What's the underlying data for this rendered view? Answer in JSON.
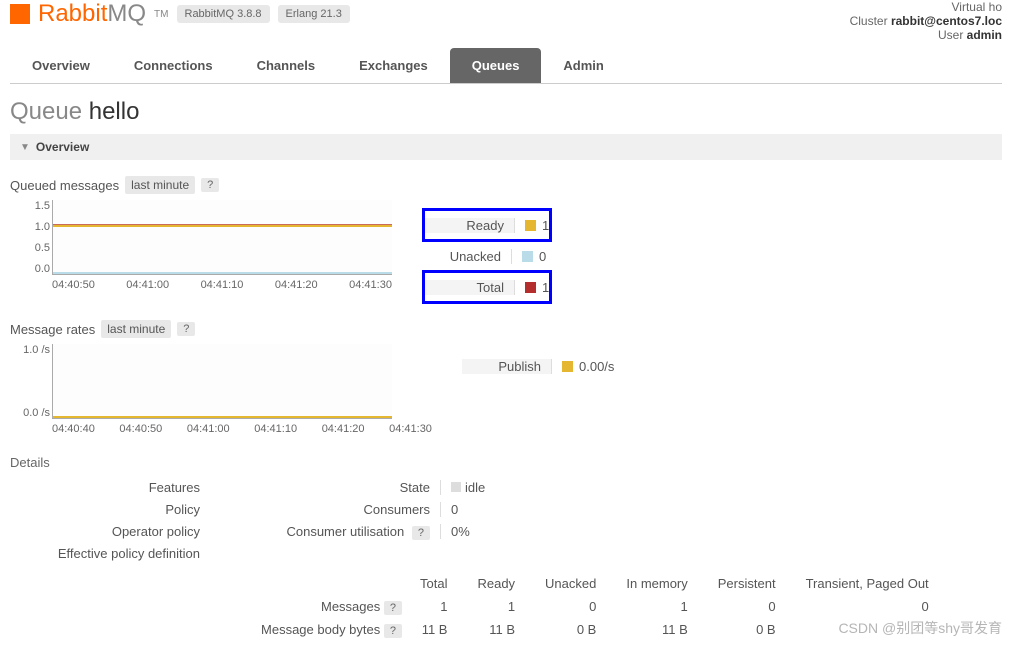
{
  "header": {
    "logo_prefix": "Rabbit",
    "logo_suffix": "MQ",
    "tm": "TM",
    "version": "RabbitMQ 3.8.8",
    "erlang": "Erlang 21.3",
    "virtual_host_label": "Virtual ho",
    "cluster_label": "Cluster ",
    "cluster_value": "rabbit@centos7.loc",
    "user_label": "User ",
    "user_value": "admin"
  },
  "tabs": [
    "Overview",
    "Connections",
    "Channels",
    "Exchanges",
    "Queues",
    "Admin"
  ],
  "active_tab": "Queues",
  "page_title_prefix": "Queue ",
  "page_title_name": "hello",
  "overview_section": "Overview",
  "queued_messages": {
    "label": "Queued messages",
    "range": "last minute",
    "help": "?",
    "y_ticks": [
      "1.5",
      "1.0",
      "0.5",
      "0.0"
    ],
    "x_ticks": [
      "04:40:50",
      "04:41:00",
      "04:41:10",
      "04:41:20",
      "04:41:30"
    ],
    "legend": [
      {
        "label": "Ready",
        "value": "1",
        "color": "#e5b62f",
        "bg": true,
        "highlight": true
      },
      {
        "label": "Unacked",
        "value": "0",
        "color": "#b9dce8",
        "bg": false,
        "highlight": false
      },
      {
        "label": "Total",
        "value": "1",
        "color": "#b52e2e",
        "bg": true,
        "highlight": true
      }
    ]
  },
  "message_rates": {
    "label": "Message rates",
    "range": "last minute",
    "help": "?",
    "y_ticks": [
      "1.0 /s",
      "0.0 /s"
    ],
    "x_ticks": [
      "04:40:40",
      "04:40:50",
      "04:41:00",
      "04:41:10",
      "04:41:20",
      "04:41:30"
    ],
    "legend": [
      {
        "label": "Publish",
        "value": "0.00/s",
        "color": "#e5b62f",
        "bg": true
      }
    ]
  },
  "details": {
    "label": "Details",
    "left": [
      {
        "label": "Features",
        "value": ""
      },
      {
        "label": "Policy",
        "value": ""
      },
      {
        "label": "Operator policy",
        "value": ""
      },
      {
        "label": "Effective policy definition",
        "value": ""
      }
    ],
    "right": [
      {
        "label": "State",
        "value": "idle",
        "icon": true
      },
      {
        "label": "Consumers",
        "value": "0"
      },
      {
        "label": "Consumer utilisation",
        "value": "0%",
        "help": true
      }
    ]
  },
  "stats": {
    "headers": [
      "Total",
      "Ready",
      "Unacked",
      "In memory",
      "Persistent",
      "Transient, Paged Out"
    ],
    "rows": [
      {
        "label": "Messages",
        "help": true,
        "values": [
          "1",
          "1",
          "0",
          "1",
          "0",
          "0"
        ]
      },
      {
        "label": "Message body bytes",
        "help": true,
        "values": [
          "11 B",
          "11 B",
          "0 B",
          "11 B",
          "0 B",
          ""
        ]
      }
    ]
  },
  "watermark": "CSDN @别团等shy哥发育"
}
